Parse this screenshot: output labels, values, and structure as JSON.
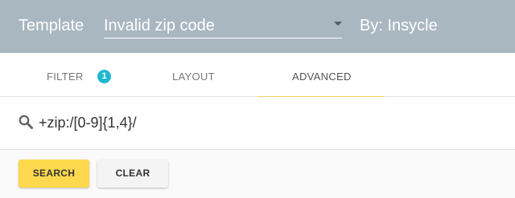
{
  "header": {
    "template_label": "Template",
    "template_value": "Invalid zip code",
    "by_label": "By: Insycle"
  },
  "tabs": [
    {
      "label": "FILTER",
      "badge": "1"
    },
    {
      "label": "LAYOUT"
    },
    {
      "label": "ADVANCED",
      "active": true
    }
  ],
  "query": {
    "value": "+zip:/[0-9]{1,4}/",
    "icon": "search-icon"
  },
  "actions": {
    "search_label": "SEARCH",
    "clear_label": "CLEAR"
  },
  "colors": {
    "header_bg": "#a9b7c1",
    "accent": "#f2d25a",
    "search_button": "#fed84d",
    "badge": "#1fb8d0"
  }
}
